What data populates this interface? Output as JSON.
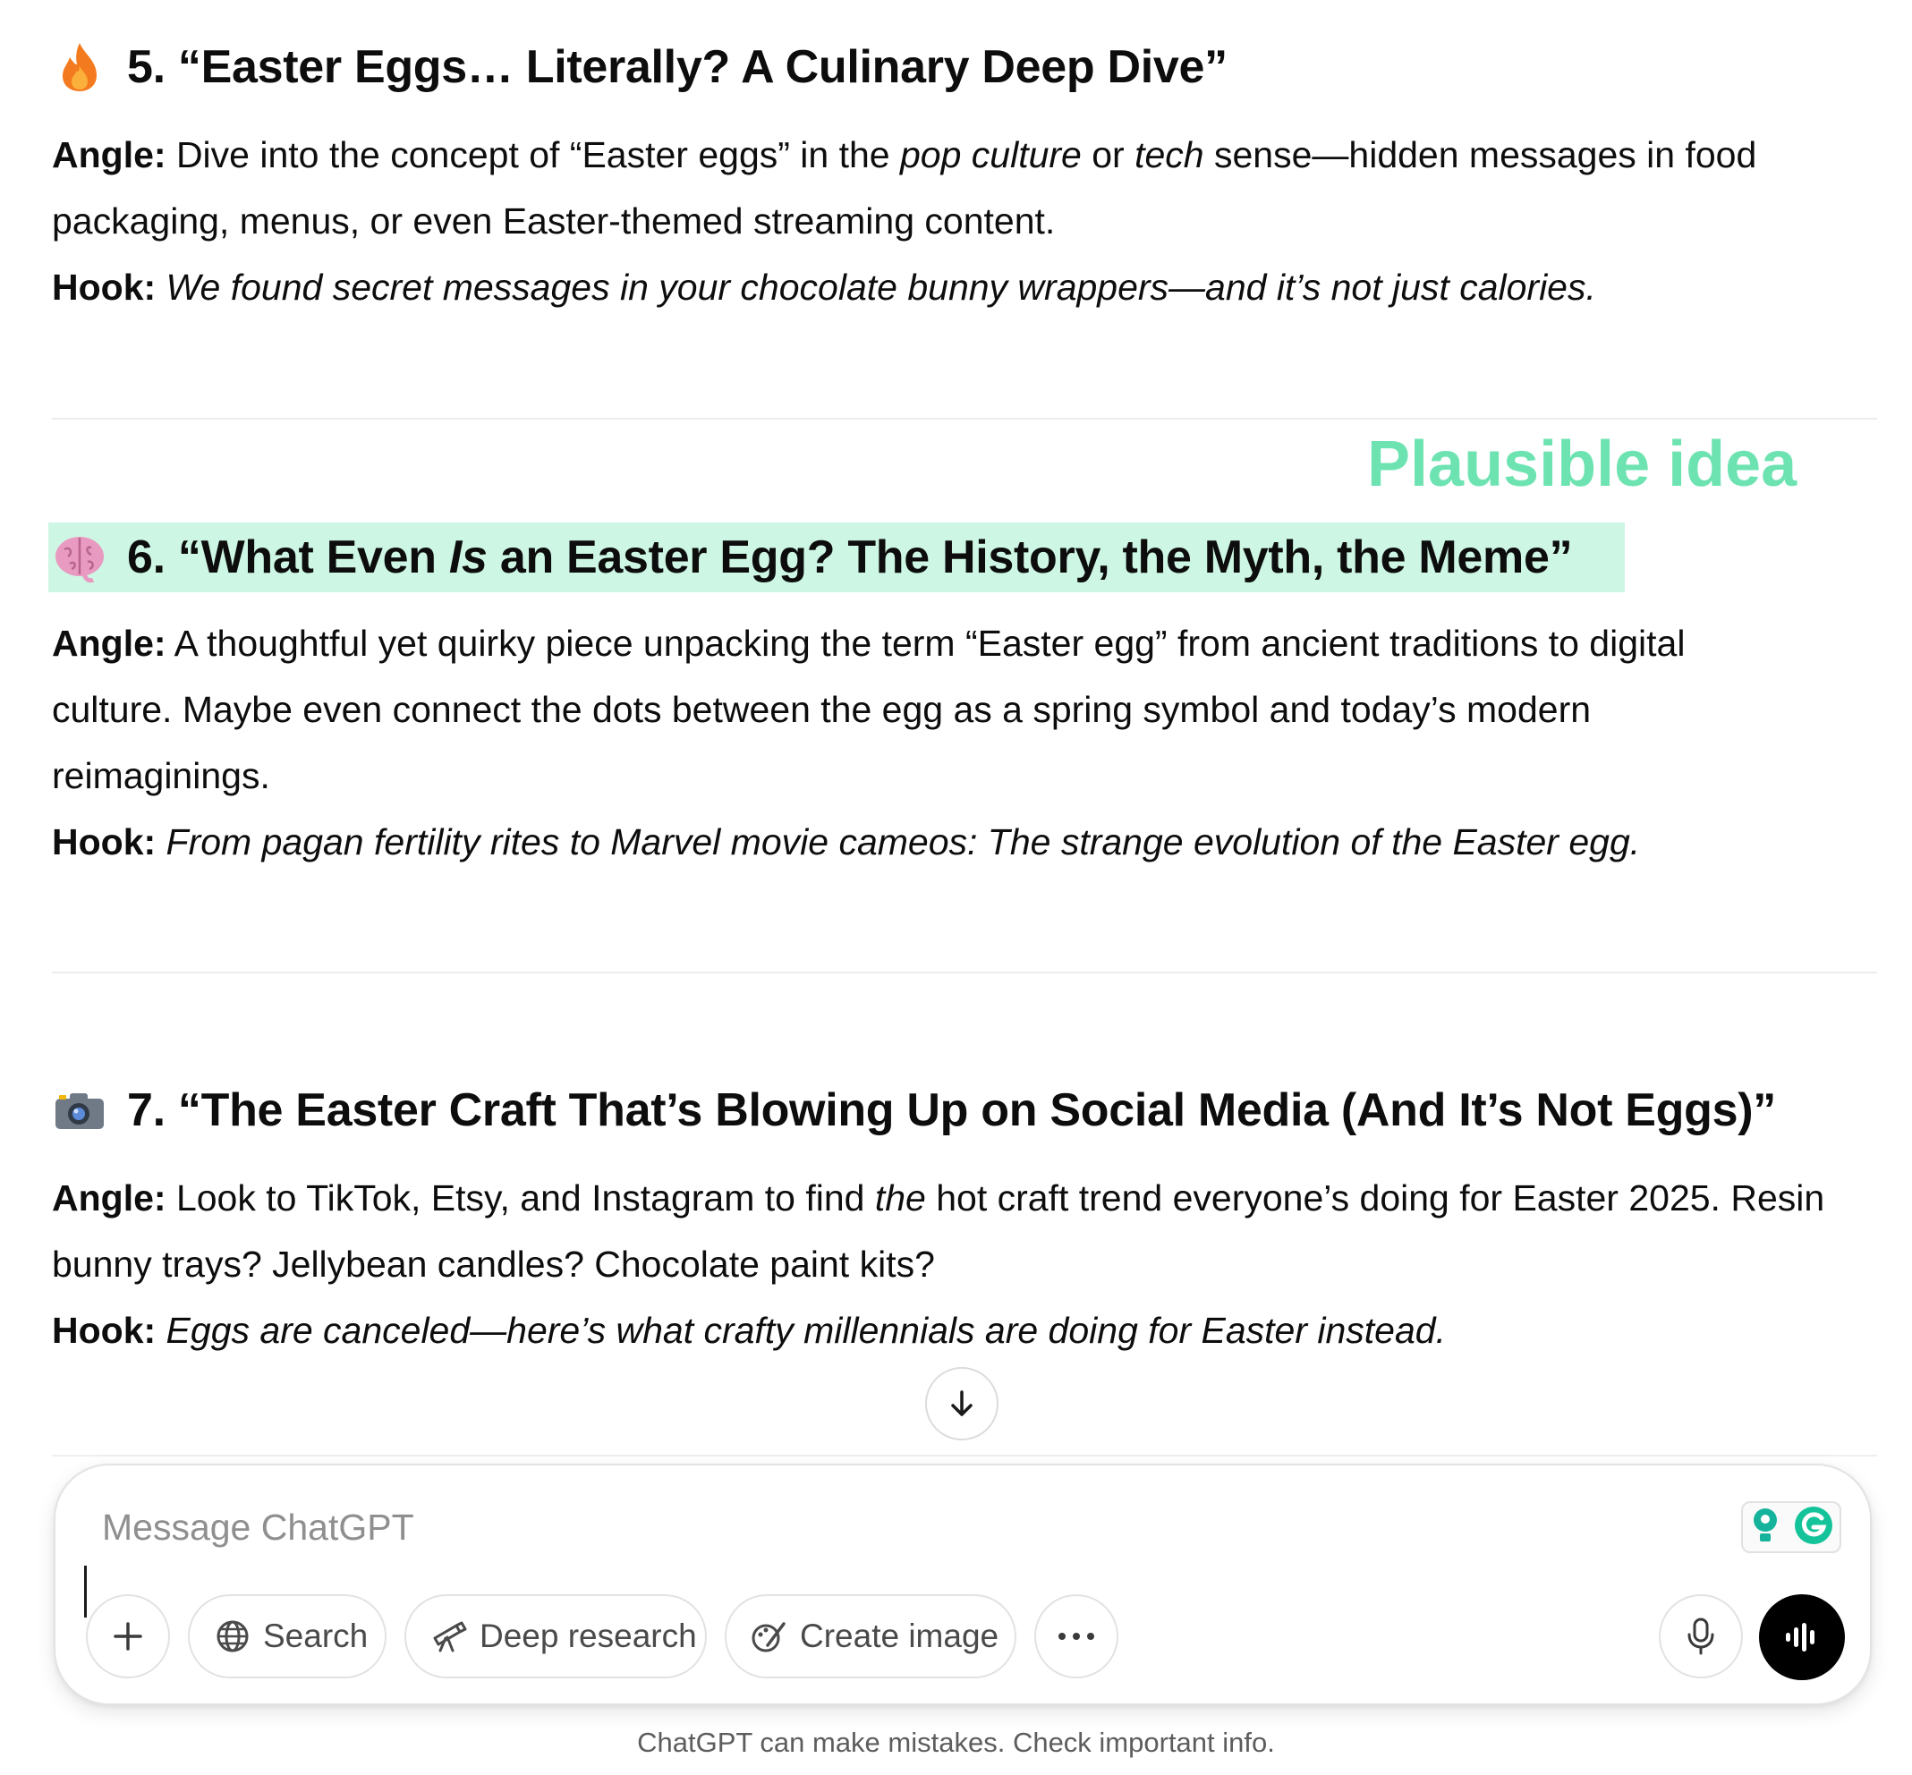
{
  "ideas": [
    {
      "emoji": "fire-icon",
      "title": "5. “Easter Eggs… Literally? A Culinary Deep Dive”",
      "angle_label": "Angle:",
      "angle_lines": [
        [
          {
            "t": " Dive into the concept of “Easter eggs” in the "
          },
          {
            "t": "pop culture",
            "i": true
          },
          {
            "t": " or "
          },
          {
            "t": "tech",
            "i": true
          },
          {
            "t": " sense—hidden messages in food"
          }
        ],
        [
          {
            "t": "packaging, menus, or even Easter-themed streaming content."
          }
        ]
      ],
      "hook_label": "Hook:",
      "hook": " We found secret messages in your chocolate bunny wrappers—and it’s not just calories."
    },
    {
      "emoji": "brain-icon",
      "title_parts": [
        {
          "t": "6. “What Even "
        },
        {
          "t": "Is",
          "i": true
        },
        {
          "t": " an Easter Egg? The History, the Myth, the Meme”"
        }
      ],
      "angle_label": "Angle:",
      "angle_lines": [
        [
          {
            "t": " A thoughtful yet quirky piece unpacking the term “Easter egg” from ancient traditions to digital"
          }
        ],
        [
          {
            "t": "culture. Maybe even connect the dots between the egg as a spring symbol and today’s modern"
          }
        ],
        [
          {
            "t": "reimaginings."
          }
        ]
      ],
      "hook_label": "Hook:",
      "hook": " From pagan fertility rites to Marvel movie cameos: The strange evolution of the Easter egg."
    },
    {
      "emoji": "camera-icon",
      "title": "7. “The Easter Craft That’s Blowing Up on Social Media (And It’s Not Eggs)”",
      "angle_label": "Angle:",
      "angle_lines": [
        [
          {
            "t": " Look to TikTok, Etsy, and Instagram to find "
          },
          {
            "t": "the",
            "i": true
          },
          {
            "t": " hot craft trend everyone’s doing for Easter 2025. Resin"
          }
        ],
        [
          {
            "t": "bunny trays? Jellybean candles? Chocolate paint kits?"
          }
        ]
      ],
      "hook_label": "Hook:",
      "hook": " Eggs are canceled—here’s what crafty millennials are doing for Easter instead."
    }
  ],
  "annotation": "Plausible idea",
  "colors": {
    "highlight": "#cdf7e4",
    "annotation": "#6ee3b2"
  },
  "composer": {
    "placeholder": "Message ChatGPT",
    "search_label": "Search",
    "deep_research_label": "Deep research",
    "create_image_label": "Create image"
  },
  "disclaimer": "ChatGPT can make mistakes. Check important info."
}
